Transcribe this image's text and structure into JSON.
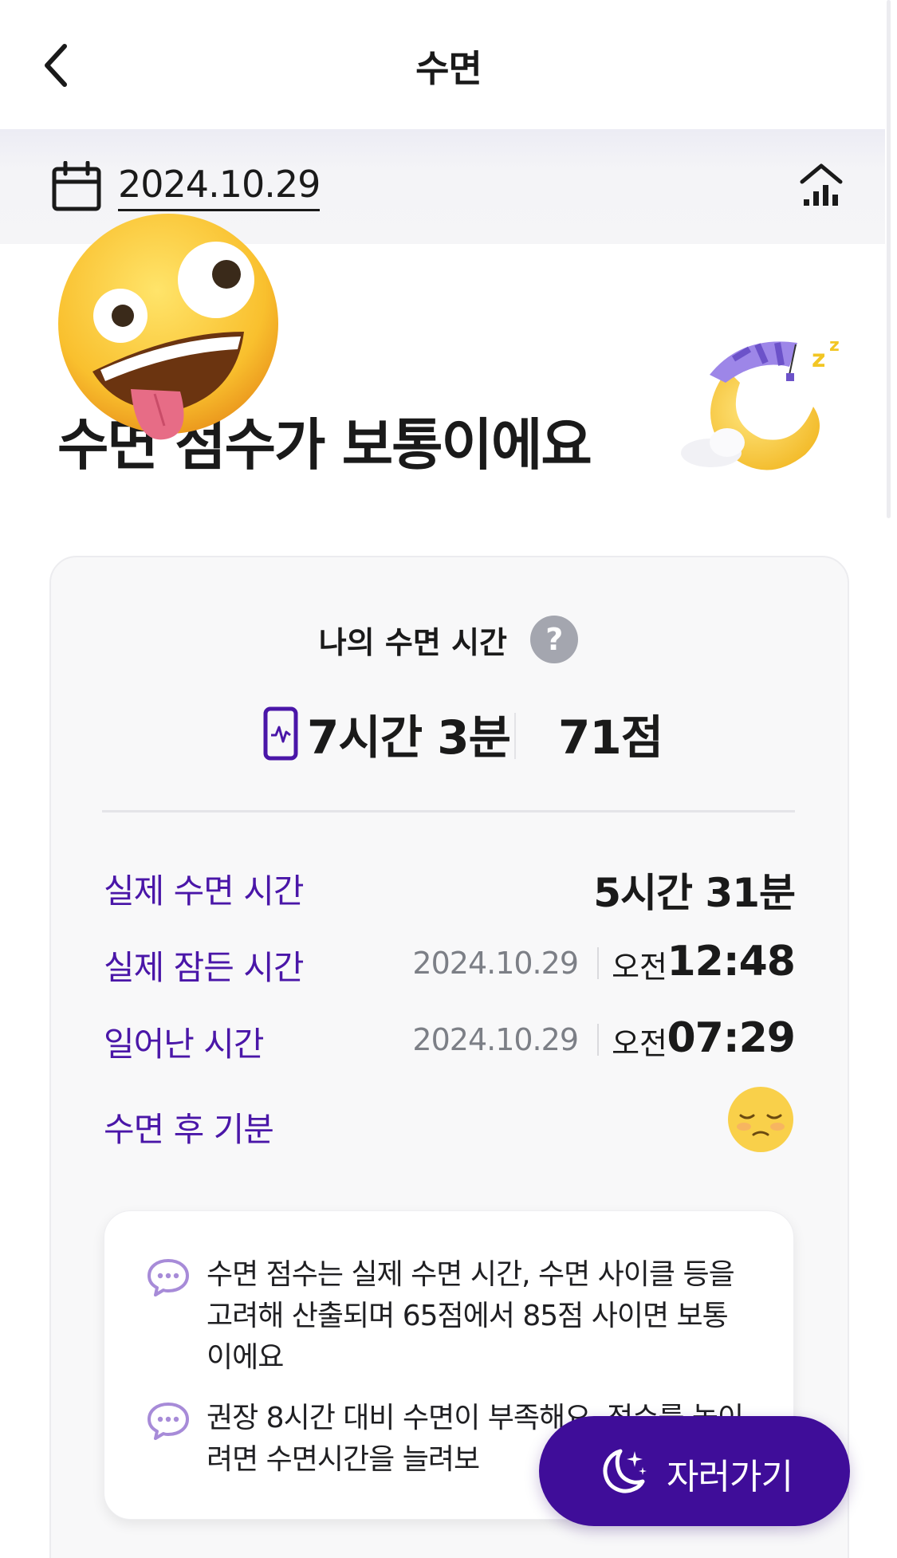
{
  "header": {
    "title": "수면",
    "back_icon": "chevron-left-icon"
  },
  "datebar": {
    "date": "2024.10.29",
    "calendar_icon": "calendar-icon",
    "stats_icon": "bar-chart-icon"
  },
  "hero": {
    "title": "수면 점수가 보통이에요",
    "sticker": "zany-face-emoji",
    "illustration": "sleeping-moon-illustration"
  },
  "card": {
    "label": "나의 수면 시간",
    "help": "?",
    "total_time": "7시간 3분",
    "score": "71점",
    "rows": [
      {
        "label": "실제 수면 시간",
        "value": "5시간 31분"
      },
      {
        "label": "실제 잠든 시간",
        "date": "2024.10.29",
        "ampm": "오전",
        "time": "12:48"
      },
      {
        "label": "일어난 시간",
        "date": "2024.10.29",
        "ampm": "오전",
        "time": "07:29"
      },
      {
        "label": "수면 후 기분",
        "mood_icon": "tired-face-icon"
      }
    ],
    "info": [
      "수면 점수는 실제 수면 시간, 수면 사이클 등을 고려해 산출되며 65점에서 85점 사이면 보통이에요",
      "권장 8시간 대비 수면이 부족해요. 점수를 높이려면 수면시간을 늘려보"
    ]
  },
  "fab": {
    "label": "자러가기",
    "icon": "moon-stars-icon"
  },
  "colors": {
    "accent": "#4a16a8",
    "fab": "#3f0d99"
  }
}
